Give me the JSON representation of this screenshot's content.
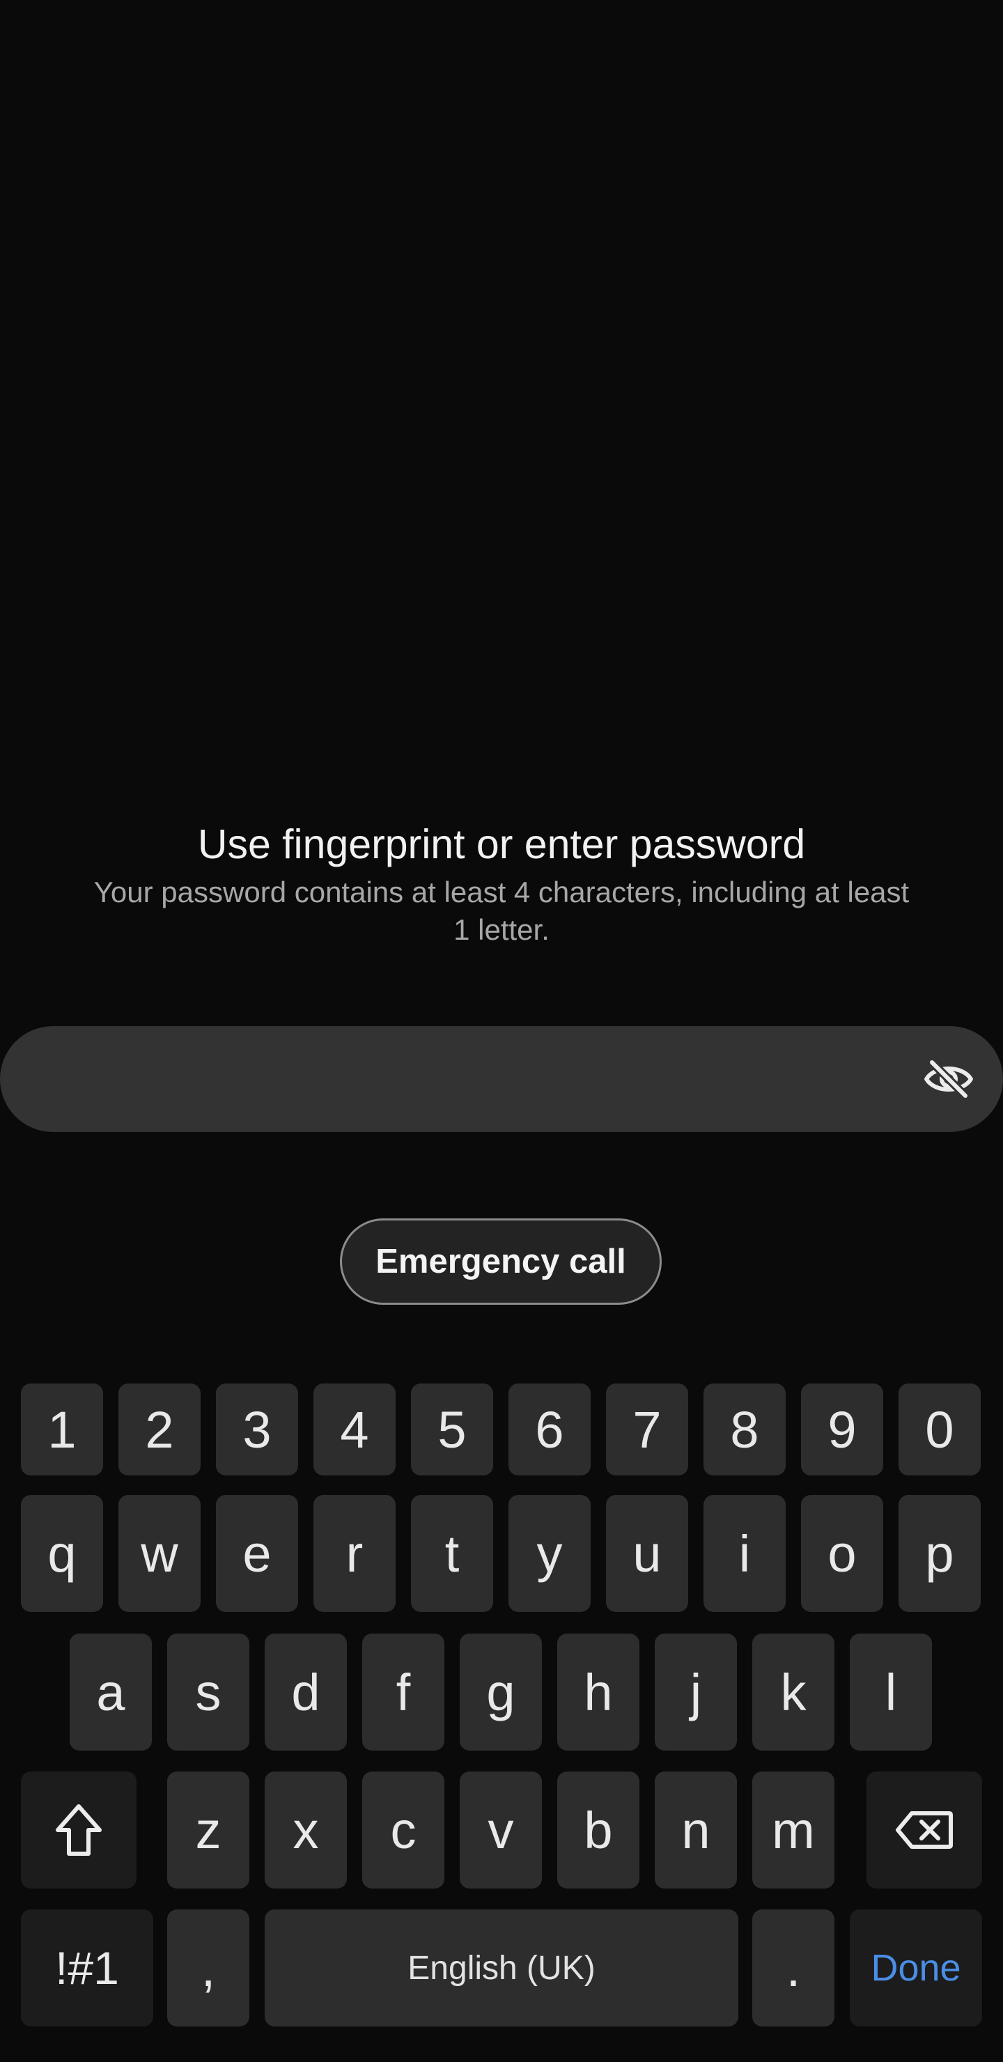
{
  "lock": {
    "title": "Use fingerprint or enter password",
    "subtitle": "Your password contains at least 4 characters, including at least 1 letter.",
    "password_value": "",
    "emergency_call_label": "Emergency call",
    "toggle_visibility_icon": "eye-off-icon"
  },
  "keyboard": {
    "numbers": [
      "1",
      "2",
      "3",
      "4",
      "5",
      "6",
      "7",
      "8",
      "9",
      "0"
    ],
    "row1": [
      "q",
      "w",
      "e",
      "r",
      "t",
      "y",
      "u",
      "i",
      "o",
      "p"
    ],
    "row2": [
      "a",
      "s",
      "d",
      "f",
      "g",
      "h",
      "j",
      "k",
      "l"
    ],
    "row3": [
      "z",
      "x",
      "c",
      "v",
      "b",
      "n",
      "m"
    ],
    "shift_icon": "shift-icon",
    "backspace_icon": "backspace-icon",
    "symbols_label": "!#1",
    "comma_label": ",",
    "space_label": "English (UK)",
    "period_label": ".",
    "done_label": "Done",
    "done_color": "#4a8ee6"
  }
}
